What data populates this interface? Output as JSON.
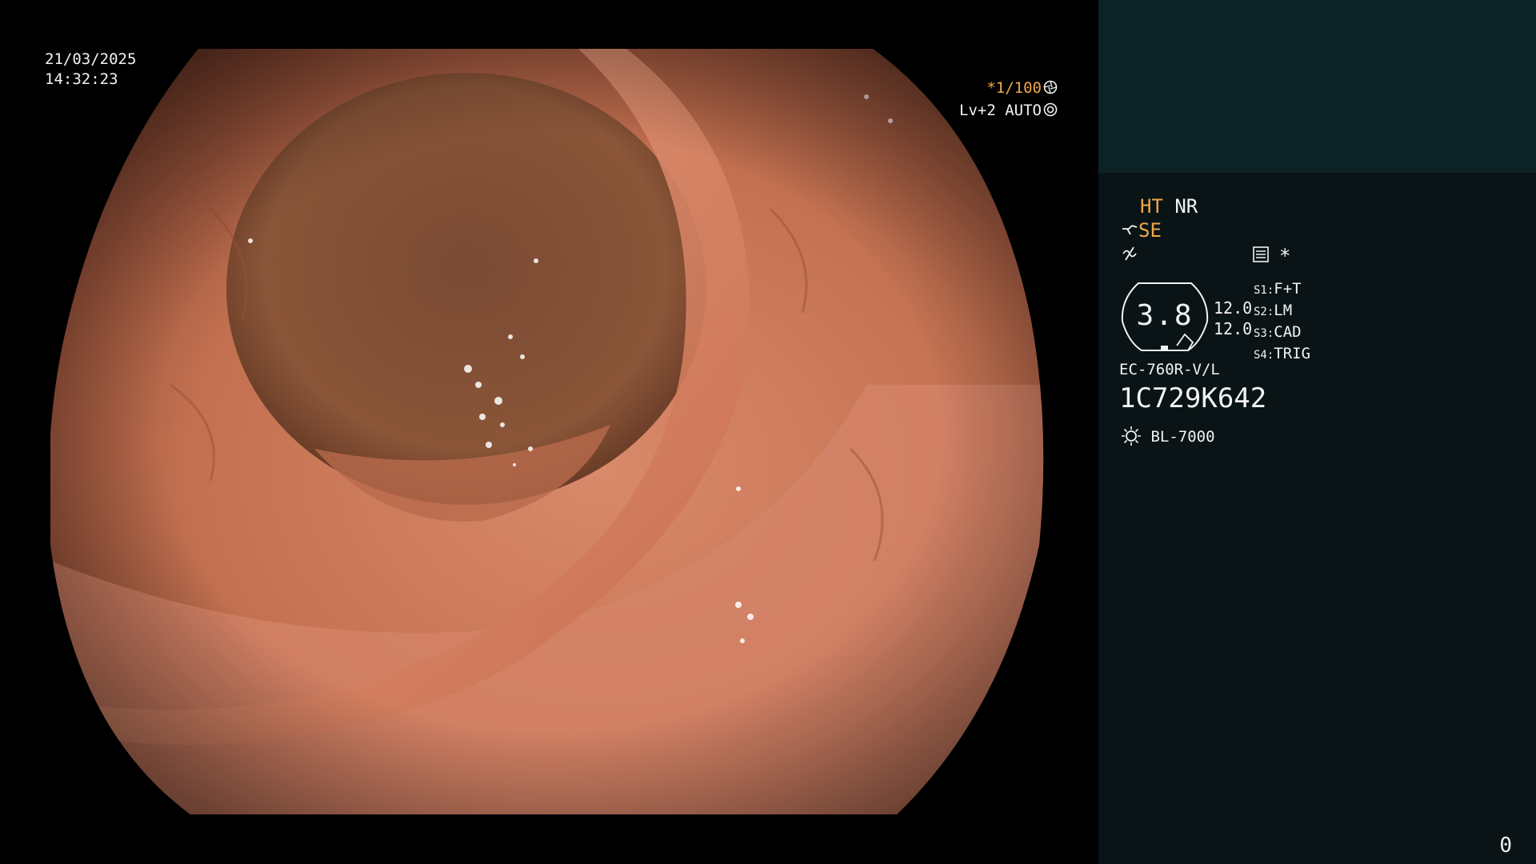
{
  "overlay": {
    "date": "21/03/2025",
    "time": "14:32:23",
    "shutter": "*1/100",
    "level_mode": "Lv+2 AUTO"
  },
  "panel": {
    "ht": "HT",
    "nr": "NR",
    "se": "SE",
    "star": "*",
    "level_value": "3.8",
    "values": [
      "12.0",
      "12.0"
    ],
    "settings": [
      {
        "slot": "S1:",
        "value": "F+T"
      },
      {
        "slot": "S2:",
        "value": "LM"
      },
      {
        "slot": "S3:",
        "value": "CAD"
      },
      {
        "slot": "S4:",
        "value": "TRIG"
      }
    ],
    "scope_model": "EC-760R-V/L",
    "serial": "1C729K642",
    "light_source": "BL-7000",
    "counter": "0"
  },
  "colors": {
    "panel_bg": "#0a1416",
    "panel_top_bg": "#0d2224",
    "accent_orange": "#f0a64a",
    "tissue": "#c8704e"
  },
  "icons": [
    "shutter-icon",
    "iris-icon",
    "scope-se-icon",
    "enhance-icon",
    "menu-icon",
    "light-source-icon"
  ]
}
